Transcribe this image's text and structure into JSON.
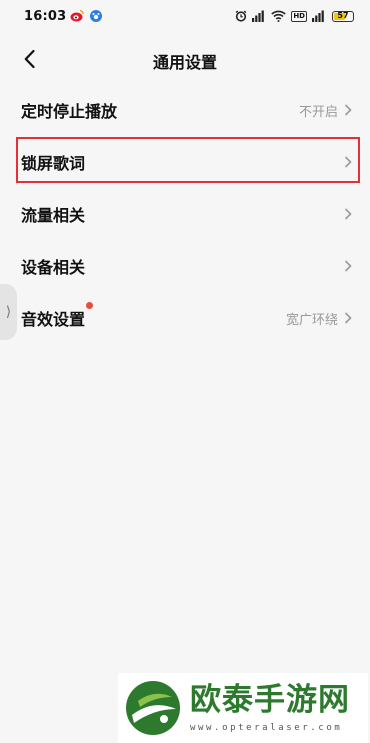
{
  "status_bar": {
    "time": "16:03",
    "app_icons": [
      "weibo-icon",
      "baidu-paw-icon"
    ],
    "system_icons": [
      "alarm-icon",
      "signal-icon",
      "wifi-icon",
      "hd-icon",
      "cell-signal-icon"
    ],
    "hd_label": "HD",
    "battery": "57"
  },
  "header": {
    "title": "通用设置"
  },
  "settings": [
    {
      "label": "定时停止播放",
      "value": "不开启"
    },
    {
      "label": "锁屏歌词",
      "value": ""
    },
    {
      "label": "流量相关",
      "value": ""
    },
    {
      "label": "设备相关",
      "value": ""
    },
    {
      "label": "音效设置",
      "value": "宽广环绕",
      "badge": "red-dot"
    }
  ],
  "highlighted_item": "锁屏歌词",
  "watermark": {
    "name": "欧泰手游网",
    "url": "www.opteralaser.com"
  },
  "colors": {
    "highlight_border": "#e5303a",
    "badge": "#e74c3c",
    "watermark_green": "#2d7a2f",
    "battery": "#f1c40f"
  }
}
